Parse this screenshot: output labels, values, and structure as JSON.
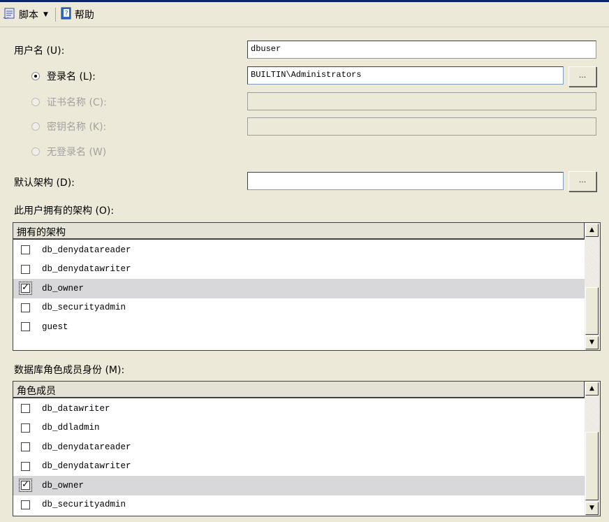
{
  "toolbar": {
    "script_label": "脚本",
    "help_label": "帮助",
    "script_icon": "script-icon",
    "help_icon": "help-book-icon"
  },
  "form": {
    "username_label": "用户名 (U):",
    "username_value": "dbuser",
    "login_name_label": "登录名 (L):",
    "login_name_value": "BUILTIN\\Administrators",
    "cert_name_label": "证书名称 (C):",
    "key_name_label": "密钥名称 (K):",
    "no_login_label": "无登录名 (W)",
    "default_schema_label": "默认架构 (D):",
    "default_schema_value": "",
    "browse_label": "..."
  },
  "owned_schemas": {
    "section_label": "此用户拥有的架构 (O):",
    "header": "拥有的架构",
    "rows": [
      {
        "name": "db_denydatareader",
        "checked": false
      },
      {
        "name": "db_denydatawriter",
        "checked": false
      },
      {
        "name": "db_owner",
        "checked": true
      },
      {
        "name": "db_securityadmin",
        "checked": false
      },
      {
        "name": "guest",
        "checked": false
      }
    ]
  },
  "role_membership": {
    "section_label": "数据库角色成员身份 (M):",
    "header": "角色成员",
    "rows": [
      {
        "name": "db_datawriter",
        "checked": false
      },
      {
        "name": "db_ddladmin",
        "checked": false
      },
      {
        "name": "db_denydatareader",
        "checked": false
      },
      {
        "name": "db_denydatawriter",
        "checked": false
      },
      {
        "name": "db_owner",
        "checked": true
      },
      {
        "name": "db_securityadmin",
        "checked": false
      }
    ]
  },
  "colors": {
    "background": "#ece9d8",
    "title_bar": "#0a246a",
    "selected_row": "#d8d7d9",
    "disabled_text": "#a4a0a0"
  }
}
